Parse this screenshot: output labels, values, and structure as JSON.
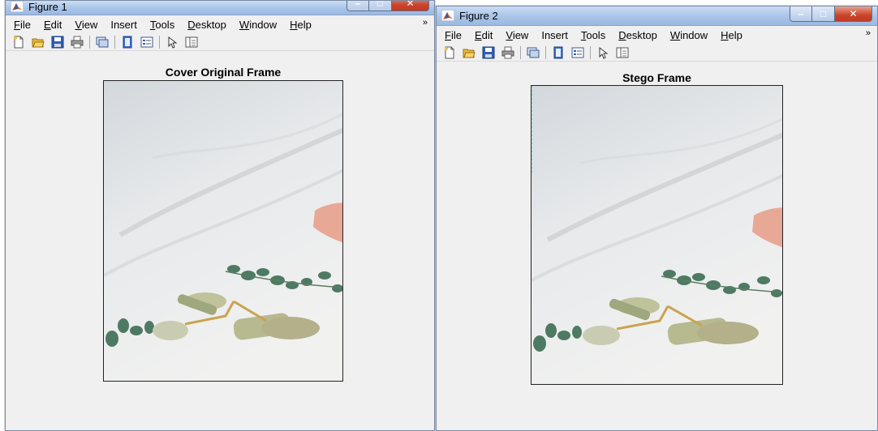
{
  "windows": [
    {
      "title": "Figure 1",
      "menu": [
        {
          "u": "F",
          "rest": "ile"
        },
        {
          "u": "E",
          "rest": "dit"
        },
        {
          "u": "V",
          "rest": "iew"
        },
        {
          "u": "",
          "rest": "Insert"
        },
        {
          "u": "T",
          "rest": "ools"
        },
        {
          "u": "D",
          "rest": "esktop"
        },
        {
          "u": "W",
          "rest": "indow"
        },
        {
          "u": "H",
          "rest": "elp"
        }
      ],
      "axes_title": "Cover Original Frame"
    },
    {
      "title": "Figure 2",
      "menu": [
        {
          "u": "F",
          "rest": "ile"
        },
        {
          "u": "E",
          "rest": "dit"
        },
        {
          "u": "V",
          "rest": "iew"
        },
        {
          "u": "",
          "rest": "Insert"
        },
        {
          "u": "T",
          "rest": "ools"
        },
        {
          "u": "D",
          "rest": "esktop"
        },
        {
          "u": "W",
          "rest": "indow"
        },
        {
          "u": "H",
          "rest": "elp"
        }
      ],
      "axes_title": "Stego Frame"
    }
  ],
  "menu_overflow": "»",
  "window_controls": {
    "minimize": "–",
    "maximize": "□",
    "close": "✕"
  },
  "toolbar_icons": [
    "new-figure-icon",
    "open-file-icon",
    "save-icon",
    "print-icon",
    "link-plot-icon",
    "colorbar-icon",
    "legend-icon",
    "edit-plot-icon",
    "property-inspector-icon"
  ],
  "colors": {
    "titlebar": "#a9c4e8",
    "close_button": "#c9442a",
    "window_bg": "#efefef",
    "matlab_icon": "#e0531b"
  }
}
